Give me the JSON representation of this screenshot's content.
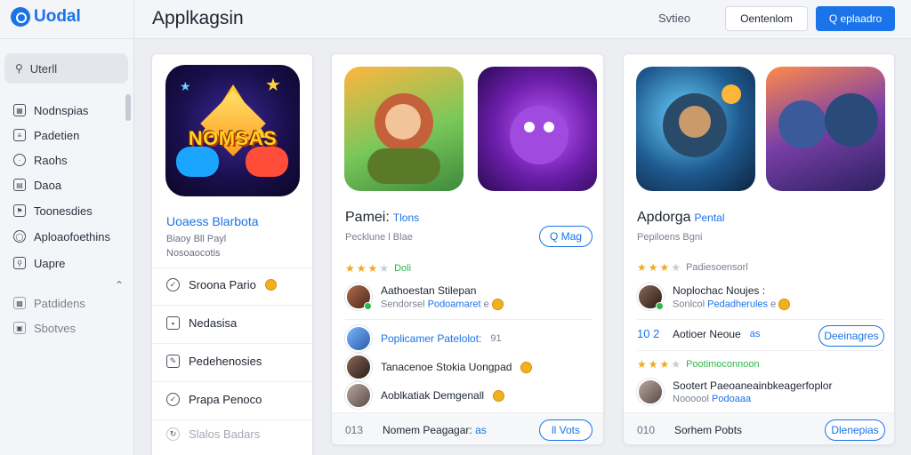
{
  "brand": {
    "name": "Uodal"
  },
  "header": {
    "title": "Applkagsin",
    "link": "Svtieo",
    "outline_button": "Oentenlom",
    "primary_button": "Q eplaadro",
    "accent_color": "#1a73e8"
  },
  "sidebar": {
    "search_label": "Uterll",
    "items": [
      {
        "label": "Nodnspias",
        "icon": "grid-icon"
      },
      {
        "label": "Padetien",
        "icon": "document-icon"
      },
      {
        "label": "Raohs",
        "icon": "circle-icon"
      },
      {
        "label": "Daoa",
        "icon": "calendar-icon"
      },
      {
        "label": "Toonesdies",
        "icon": "flag-icon"
      },
      {
        "label": "Aploaofoethins",
        "icon": "globe-icon"
      },
      {
        "label": "Uapre",
        "icon": "map-pin-icon"
      },
      {
        "label": "Patdidens",
        "icon": "chart-icon"
      },
      {
        "label": "Sbotves",
        "icon": "box-icon"
      }
    ]
  },
  "card1": {
    "logo_text": "NOMSAS",
    "title": "Uoaess Blarbota",
    "subtitle": "Biaoy Bll Payl",
    "meta": "Nosoaocotis",
    "rows": [
      {
        "label": "Sroona Pario",
        "icon": "check-circle-icon",
        "coin": true
      },
      {
        "label": "Nedasisa",
        "icon": "square-icon",
        "coin": false
      },
      {
        "label": "Pedehenosies",
        "icon": "edit-icon",
        "coin": false
      },
      {
        "label": "Prapa Penoco",
        "icon": "check-icon",
        "coin": false
      },
      {
        "label": "Slalos Badars",
        "icon": "refresh-icon",
        "coin": false
      }
    ]
  },
  "card2": {
    "title": "Pamei:",
    "tag": "Tlons",
    "subtitle": "Pecklune l Blae",
    "pill": "Q Mag",
    "rating": {
      "stars": 3,
      "label": "Doli"
    },
    "rows": [
      {
        "title": "Aathoestan Stilepan",
        "sub_prefix": "Sendorsel",
        "sub_link": "Podoamaret",
        "sub_suffix": "e"
      },
      {
        "title": "Poplicamer Patelolot:",
        "sub_prefix": "",
        "sub_link": "",
        "sub_suffix": "91"
      },
      {
        "title": "Tanacenoe Stokia Uongpad",
        "sub_prefix": "",
        "sub_link": "",
        "sub_suffix": ""
      },
      {
        "title": "Aoblkatiak Demgenall",
        "sub_prefix": "",
        "sub_link": "",
        "sub_suffix": ""
      }
    ],
    "footer": {
      "count": "013",
      "text": "Nomem Peagagar:",
      "link": "as",
      "pill": "ll Vots"
    }
  },
  "card3": {
    "title": "Apdorga",
    "tag": "Pental",
    "subtitle": "Pepiloens Bgni",
    "rating": {
      "stars": 3,
      "label": "Padiesoensorl"
    },
    "rows": [
      {
        "title": "Noplochac Noujes :",
        "sub_prefix": "Sonlcol",
        "sub_link": "Pedadherules",
        "sub_suffix": "e"
      },
      {
        "title": "Sootert Paeoaneainbkeagerfoplor",
        "sub_prefix": "Noooool",
        "sub_link": "Podoaaa",
        "sub_suffix": ""
      }
    ],
    "mid": {
      "count": "10 2",
      "text": "Aotioer Neoue",
      "link": "as",
      "pill": "Deeinagres"
    },
    "rating2": {
      "stars": 3,
      "label": "Pootimoconnoon"
    },
    "footer": {
      "count": "010",
      "text": "Sorhem Pobts",
      "pill": "Dlenepias"
    }
  }
}
